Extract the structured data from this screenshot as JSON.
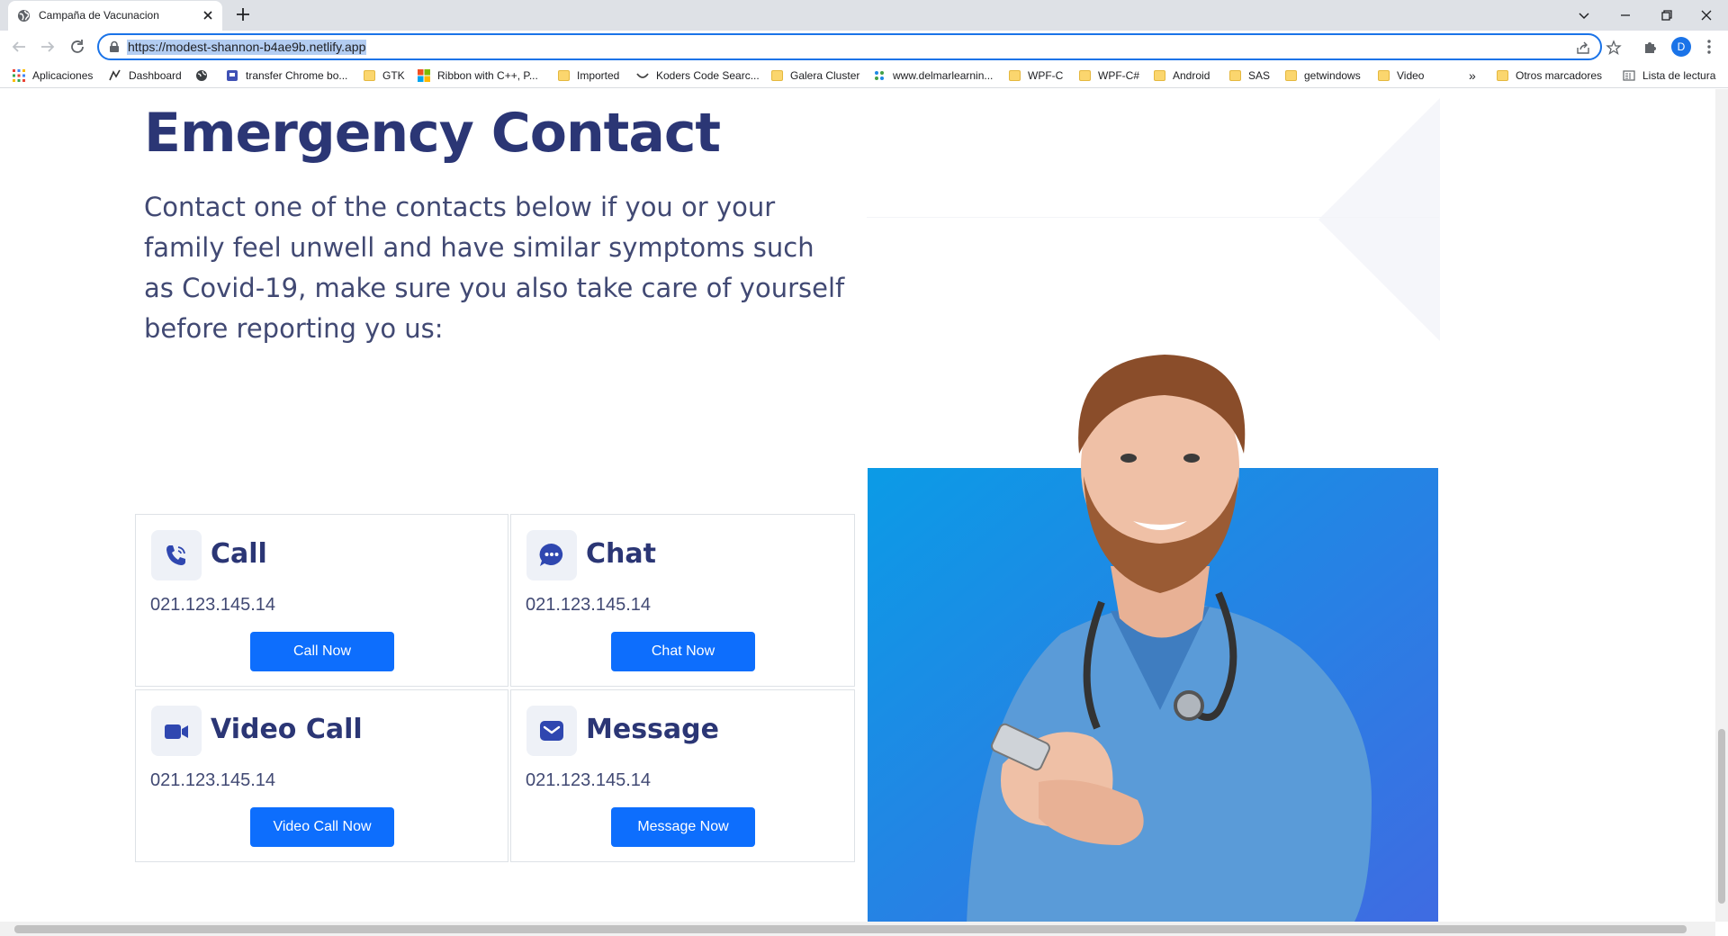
{
  "browser": {
    "tab": {
      "title": "Campaña de Vacunacion"
    },
    "address_bar": {
      "url": "https://modest-shannon-b4ae9b.netlify.app"
    },
    "profile_initial": "D",
    "bookmarks": [
      {
        "label": "Aplicaciones",
        "icon": "apps-grid-icon"
      },
      {
        "label": "Dashboard",
        "icon": "dashboard-icon"
      },
      {
        "label": "",
        "icon": "globe-icon"
      },
      {
        "label": "transfer Chrome bo...",
        "icon": "chrome-app-icon"
      },
      {
        "label": "GTK",
        "icon": "folder-icon"
      },
      {
        "label": "Ribbon with C++, P...",
        "icon": "windows-logo-icon"
      },
      {
        "label": "Imported",
        "icon": "folder-icon"
      },
      {
        "label": "Koders Code Searc...",
        "icon": "koders-icon"
      },
      {
        "label": "Galera Cluster",
        "icon": "folder-icon"
      },
      {
        "label": "www.delmarlearnin...",
        "icon": "delmar-icon"
      },
      {
        "label": "WPF-C",
        "icon": "folder-icon"
      },
      {
        "label": "WPF-C#",
        "icon": "folder-icon"
      },
      {
        "label": "Android",
        "icon": "folder-icon"
      },
      {
        "label": "SAS",
        "icon": "folder-icon"
      },
      {
        "label": "getwindows",
        "icon": "folder-icon"
      },
      {
        "label": "Video",
        "icon": "folder-icon"
      }
    ],
    "overflow_label": "»",
    "other_bookmarks": "Otros marcadores",
    "reading_list": "Lista de lectura"
  },
  "page": {
    "title": "Emergency Contact",
    "description": "Contact one of the contacts below if you or your family feel unwell and have similar symptoms such as Covid-19, make sure you also take care of yourself before reporting yo us:",
    "contacts": [
      {
        "title": "Call",
        "phone": "021.123.145.14",
        "button": "Call Now",
        "icon": "phone-icon"
      },
      {
        "title": "Chat",
        "phone": "021.123.145.14",
        "button": "Chat Now",
        "icon": "chat-bubble-icon"
      },
      {
        "title": "Video Call",
        "phone": "021.123.145.14",
        "button": "Video Call Now",
        "icon": "video-camera-icon"
      },
      {
        "title": "Message",
        "phone": "021.123.145.14",
        "button": "Message Now",
        "icon": "envelope-icon"
      }
    ],
    "colors": {
      "heading": "#2b3675",
      "body_text": "#414973",
      "button": "#0d6efd",
      "image_bg_start": "#0b9be6",
      "image_bg_end": "#3f6be2",
      "scrubs": "#5a9bd8"
    }
  }
}
